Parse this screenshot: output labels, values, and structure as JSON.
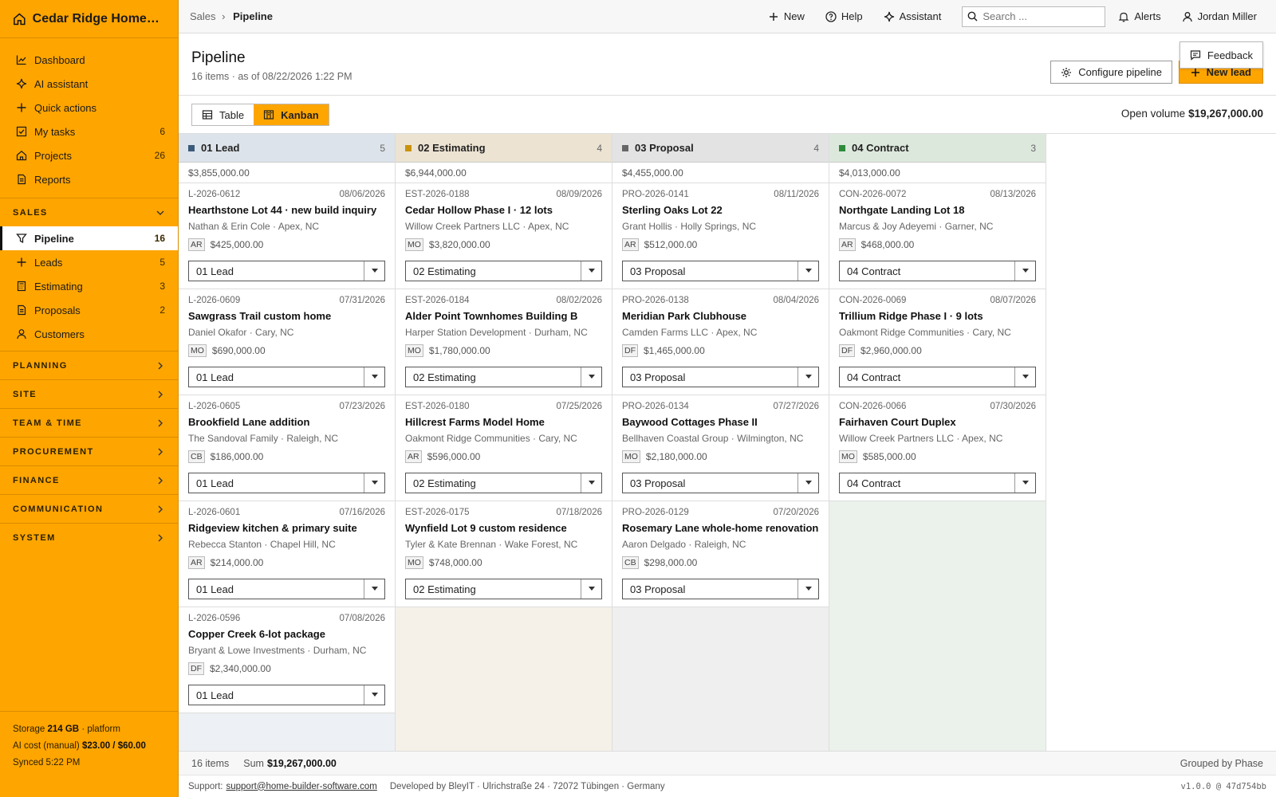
{
  "app": {
    "title": "Cedar Ridge Homes L..."
  },
  "sidebar": {
    "top_items": [
      {
        "label": "Dashboard",
        "count": ""
      },
      {
        "label": "AI assistant",
        "count": ""
      },
      {
        "label": "Quick actions",
        "count": ""
      },
      {
        "label": "My tasks",
        "count": "6"
      },
      {
        "label": "Projects",
        "count": "26"
      },
      {
        "label": "Reports",
        "count": ""
      }
    ],
    "sales_section": "SALES",
    "sales_items": [
      {
        "label": "Pipeline",
        "count": "16"
      },
      {
        "label": "Leads",
        "count": "5"
      },
      {
        "label": "Estimating",
        "count": "3"
      },
      {
        "label": "Proposals",
        "count": "2"
      },
      {
        "label": "Customers",
        "count": ""
      }
    ],
    "sections": [
      "PLANNING",
      "SITE",
      "TEAM & TIME",
      "PROCUREMENT",
      "FINANCE",
      "COMMUNICATION",
      "SYSTEM"
    ],
    "footer": {
      "storage_label": "Storage",
      "storage_value": "214 GB",
      "storage_suffix": "· platform",
      "ai_label": "AI cost (manual)",
      "ai_value": "$23.00 / $60.00",
      "synced": "Synced 5:22 PM"
    }
  },
  "topbar": {
    "breadcrumb_root": "Sales",
    "breadcrumb_sep": "›",
    "breadcrumb_current": "Pipeline",
    "new_label": "New",
    "help_label": "Help",
    "assistant_label": "Assistant",
    "search_placeholder": "Search ...",
    "alerts_label": "Alerts",
    "user_name": "Jordan Miller"
  },
  "header": {
    "title": "Pipeline",
    "subtitle": "16 items · as of 08/22/2026 1:22 PM",
    "configure_label": "Configure pipeline",
    "new_lead_label": "New lead",
    "feedback_label": "Feedback"
  },
  "view": {
    "table_label": "Table",
    "kanban_label": "Kanban",
    "open_volume_label": "Open volume",
    "open_volume_value": "$19,267,000.00"
  },
  "columns": [
    {
      "name": "01 Lead",
      "count": "5",
      "sum": "$3,855,000.00",
      "color": "#3c5a7a",
      "head_bg": "#dde3ea",
      "body_bg": "#edf1f5",
      "cards": [
        {
          "id": "L-2026-0612",
          "date": "08/06/2026",
          "title": "Hearthstone Lot 44 · new build inquiry",
          "meta": "Nathan & Erin Cole · Apex, NC",
          "initials": "AR",
          "amount": "$425,000.00",
          "stage": "01 Lead"
        },
        {
          "id": "L-2026-0609",
          "date": "07/31/2026",
          "title": "Sawgrass Trail custom home",
          "meta": "Daniel Okafor · Cary, NC",
          "initials": "MO",
          "amount": "$690,000.00",
          "stage": "01 Lead"
        },
        {
          "id": "L-2026-0605",
          "date": "07/23/2026",
          "title": "Brookfield Lane addition",
          "meta": "The Sandoval Family · Raleigh, NC",
          "initials": "CB",
          "amount": "$186,000.00",
          "stage": "01 Lead"
        },
        {
          "id": "L-2026-0601",
          "date": "07/16/2026",
          "title": "Ridgeview kitchen & primary suite",
          "meta": "Rebecca Stanton · Chapel Hill, NC",
          "initials": "AR",
          "amount": "$214,000.00",
          "stage": "01 Lead"
        },
        {
          "id": "L-2026-0596",
          "date": "07/08/2026",
          "title": "Copper Creek 6-lot package",
          "meta": "Bryant & Lowe Investments · Durham, NC",
          "initials": "DF",
          "amount": "$2,340,000.00",
          "stage": "01 Lead"
        }
      ]
    },
    {
      "name": "02 Estimating",
      "count": "4",
      "sum": "$6,944,000.00",
      "color": "#c9930c",
      "head_bg": "#ece3d2",
      "body_bg": "#f6f1e8",
      "cards": [
        {
          "id": "EST-2026-0188",
          "date": "08/09/2026",
          "title": "Cedar Hollow Phase I · 12 lots",
          "meta": "Willow Creek Partners LLC · Apex, NC",
          "initials": "MO",
          "amount": "$3,820,000.00",
          "stage": "02 Estimating"
        },
        {
          "id": "EST-2026-0184",
          "date": "08/02/2026",
          "title": "Alder Point Townhomes Building B",
          "meta": "Harper Station Development · Durham, NC",
          "initials": "MO",
          "amount": "$1,780,000.00",
          "stage": "02 Estimating"
        },
        {
          "id": "EST-2026-0180",
          "date": "07/25/2026",
          "title": "Hillcrest Farms Model Home",
          "meta": "Oakmont Ridge Communities · Cary, NC",
          "initials": "AR",
          "amount": "$596,000.00",
          "stage": "02 Estimating"
        },
        {
          "id": "EST-2026-0175",
          "date": "07/18/2026",
          "title": "Wynfield Lot 9 custom residence",
          "meta": "Tyler & Kate Brennan · Wake Forest, NC",
          "initials": "MO",
          "amount": "$748,000.00",
          "stage": "02 Estimating"
        }
      ]
    },
    {
      "name": "03 Proposal",
      "count": "4",
      "sum": "$4,455,000.00",
      "color": "#666666",
      "head_bg": "#e3e3e3",
      "body_bg": "#efefef",
      "cards": [
        {
          "id": "PRO-2026-0141",
          "date": "08/11/2026",
          "title": "Sterling Oaks Lot 22",
          "meta": "Grant Hollis · Holly Springs, NC",
          "initials": "AR",
          "amount": "$512,000.00",
          "stage": "03 Proposal"
        },
        {
          "id": "PRO-2026-0138",
          "date": "08/04/2026",
          "title": "Meridian Park Clubhouse",
          "meta": "Camden Farms LLC · Apex, NC",
          "initials": "DF",
          "amount": "$1,465,000.00",
          "stage": "03 Proposal"
        },
        {
          "id": "PRO-2026-0134",
          "date": "07/27/2026",
          "title": "Baywood Cottages Phase II",
          "meta": "Bellhaven Coastal Group · Wilmington, NC",
          "initials": "MO",
          "amount": "$2,180,000.00",
          "stage": "03 Proposal"
        },
        {
          "id": "PRO-2026-0129",
          "date": "07/20/2026",
          "title": "Rosemary Lane whole-home renovation",
          "meta": "Aaron Delgado · Raleigh, NC",
          "initials": "CB",
          "amount": "$298,000.00",
          "stage": "03 Proposal"
        }
      ]
    },
    {
      "name": "04 Contract",
      "count": "3",
      "sum": "$4,013,000.00",
      "color": "#2e8b3a",
      "head_bg": "#dde8dd",
      "body_bg": "#ebf1eb",
      "cards": [
        {
          "id": "CON-2026-0072",
          "date": "08/13/2026",
          "title": "Northgate Landing Lot 18",
          "meta": "Marcus & Joy Adeyemi · Garner, NC",
          "initials": "AR",
          "amount": "$468,000.00",
          "stage": "04 Contract"
        },
        {
          "id": "CON-2026-0069",
          "date": "08/07/2026",
          "title": "Trillium Ridge Phase I · 9 lots",
          "meta": "Oakmont Ridge Communities · Cary, NC",
          "initials": "DF",
          "amount": "$2,960,000.00",
          "stage": "04 Contract"
        },
        {
          "id": "CON-2026-0066",
          "date": "07/30/2026",
          "title": "Fairhaven Court Duplex",
          "meta": "Willow Creek Partners LLC · Apex, NC",
          "initials": "MO",
          "amount": "$585,000.00",
          "stage": "04 Contract"
        }
      ]
    }
  ],
  "footer": {
    "items": "16 items",
    "sum_label": "Sum",
    "sum_value": "$19,267,000.00",
    "grouped": "Grouped by Phase",
    "support_label": "Support:",
    "support_email": "support@home-builder-software.com",
    "developer": "Developed by BleyIT · Ulrichstraße 24 · 72072 Tübingen · Germany",
    "version": "v1.0.0 @ 47d754bb"
  }
}
